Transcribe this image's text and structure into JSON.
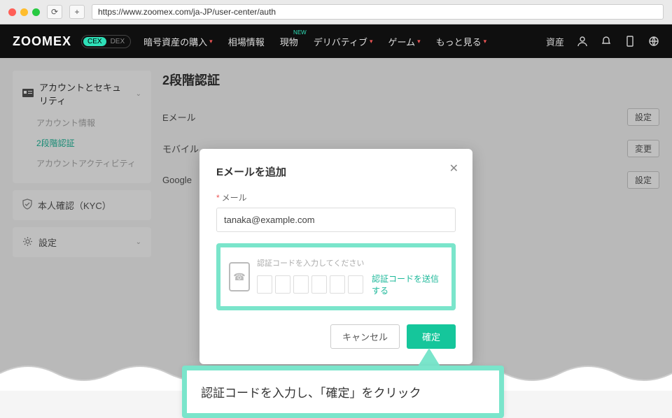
{
  "browser": {
    "url": "https://www.zoomex.com/ja-JP/user-center/auth"
  },
  "nav": {
    "logo": "ZOOMEX",
    "cex": "CEX",
    "dex": "DEX",
    "items": {
      "buy": "暗号資産の購入",
      "market": "相場情報",
      "spot": "現物",
      "spot_badge": "NEW",
      "deriv": "デリバティブ",
      "game": "ゲーム",
      "more": "もっと見る"
    },
    "assets": "資産"
  },
  "sidebar": {
    "security": {
      "title": "アカウントとセキュリティ",
      "info": "アカウント情報",
      "twofa": "2段階認証",
      "activity": "アカウントアクティビティ"
    },
    "kyc": "本人確認（KYC）",
    "settings": "設定"
  },
  "main": {
    "heading": "2段階認証",
    "rows": {
      "email": "Eメール",
      "mobile": "モバイル",
      "google": "Google"
    },
    "btn_set": "設定",
    "btn_change": "変更"
  },
  "modal": {
    "title": "Eメールを追加",
    "email_label": "メール",
    "email_value": "tanaka@example.com",
    "code_hint": "認証コードを入力してください",
    "send_code": "認証コードを送信する",
    "cancel": "キャンセル",
    "confirm": "確定"
  },
  "callout": {
    "text": "認証コードを入力し、「確定」をクリック"
  }
}
